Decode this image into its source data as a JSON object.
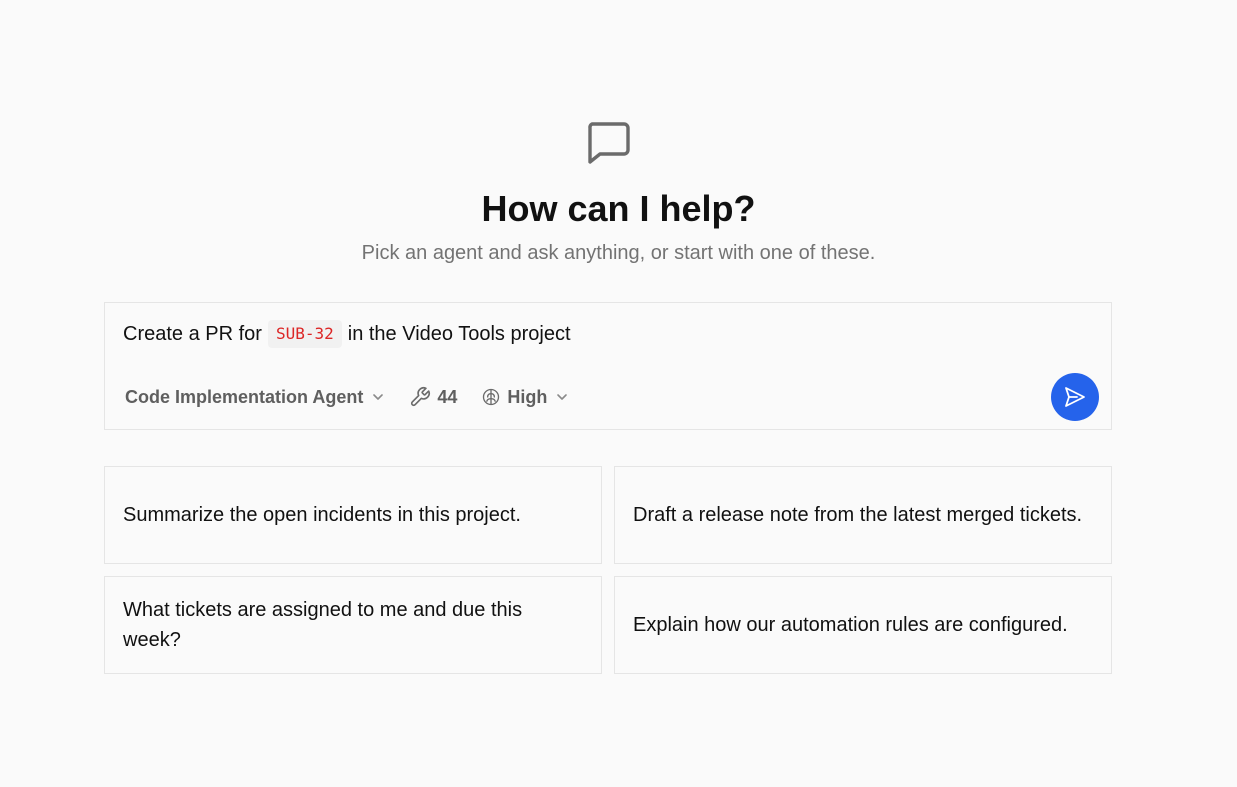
{
  "hero": {
    "icon": "chat-bubble-icon",
    "title": "How can I help?",
    "subtitle": "Pick an agent and ask anything, or start with one of these."
  },
  "composer": {
    "prompt_before": "Create a PR for",
    "ticket": "SUB-32",
    "prompt_after": "in the Video Tools project",
    "agent_label": "Code Implementation Agent",
    "tools_count": "44",
    "reasoning_label": "High",
    "send_icon": "send-icon"
  },
  "suggestions": [
    {
      "text": "Summarize the open incidents in this project."
    },
    {
      "text": "Draft a release note from the latest merged tickets."
    },
    {
      "text": "What tickets are assigned to me and due this week?"
    },
    {
      "text": "Explain how our automation rules are configured."
    }
  ],
  "colors": {
    "accent": "#2563eb",
    "ticket_text": "#dc2626",
    "background": "#fafafa",
    "border": "#e5e5e5"
  }
}
